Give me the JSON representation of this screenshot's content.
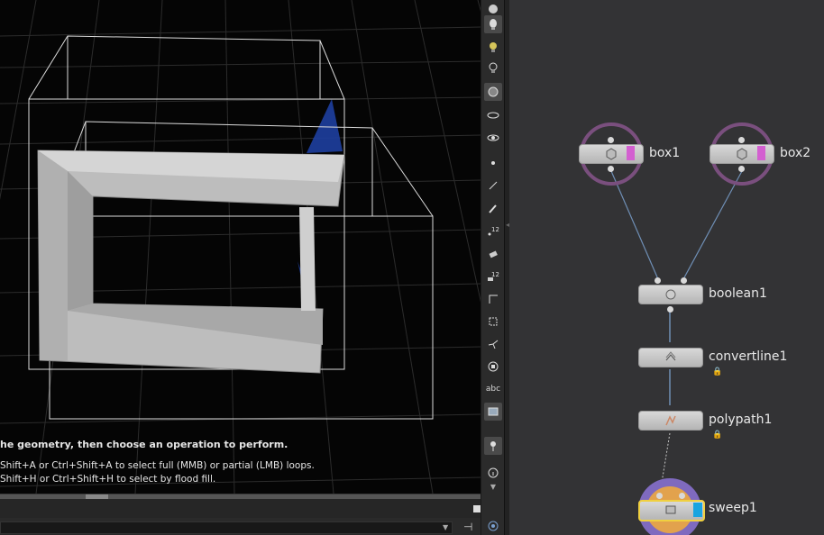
{
  "viewport": {
    "hint_line1": "he geometry, then choose an operation to perform.",
    "hint_line2": "Shift+A or Ctrl+Shift+A to select full (MMB) or partial (LMB) loops.",
    "hint_line3": "Shift+H or Ctrl+Shift+H to select by flood fill."
  },
  "toolbar": {
    "items": [
      "camera-icon",
      "light-icon",
      "bulb-icon",
      "bulb-outline-icon",
      "shading-icon",
      "eye-icon",
      "visibility-icon",
      "point-icon",
      "normal-icon",
      "pen-icon",
      "point-number-icon",
      "brush-icon",
      "prim-number-icon",
      "corner-icon",
      "grid-snap-icon",
      "transform-icon",
      "stop-icon"
    ],
    "abc_label": "abc"
  },
  "nodes": [
    {
      "id": "box1",
      "label": "box1"
    },
    {
      "id": "box2",
      "label": "box2"
    },
    {
      "id": "boolean1",
      "label": "boolean1"
    },
    {
      "id": "convertline1",
      "label": "convertline1"
    },
    {
      "id": "polypath1",
      "label": "polypath1"
    },
    {
      "id": "sweep1",
      "label": "sweep1"
    }
  ],
  "colors": {
    "display_flag": "#19a4e0",
    "template_flag": "#d35fd0",
    "selection": "#f0d040",
    "wire": "#6f8fb5"
  }
}
